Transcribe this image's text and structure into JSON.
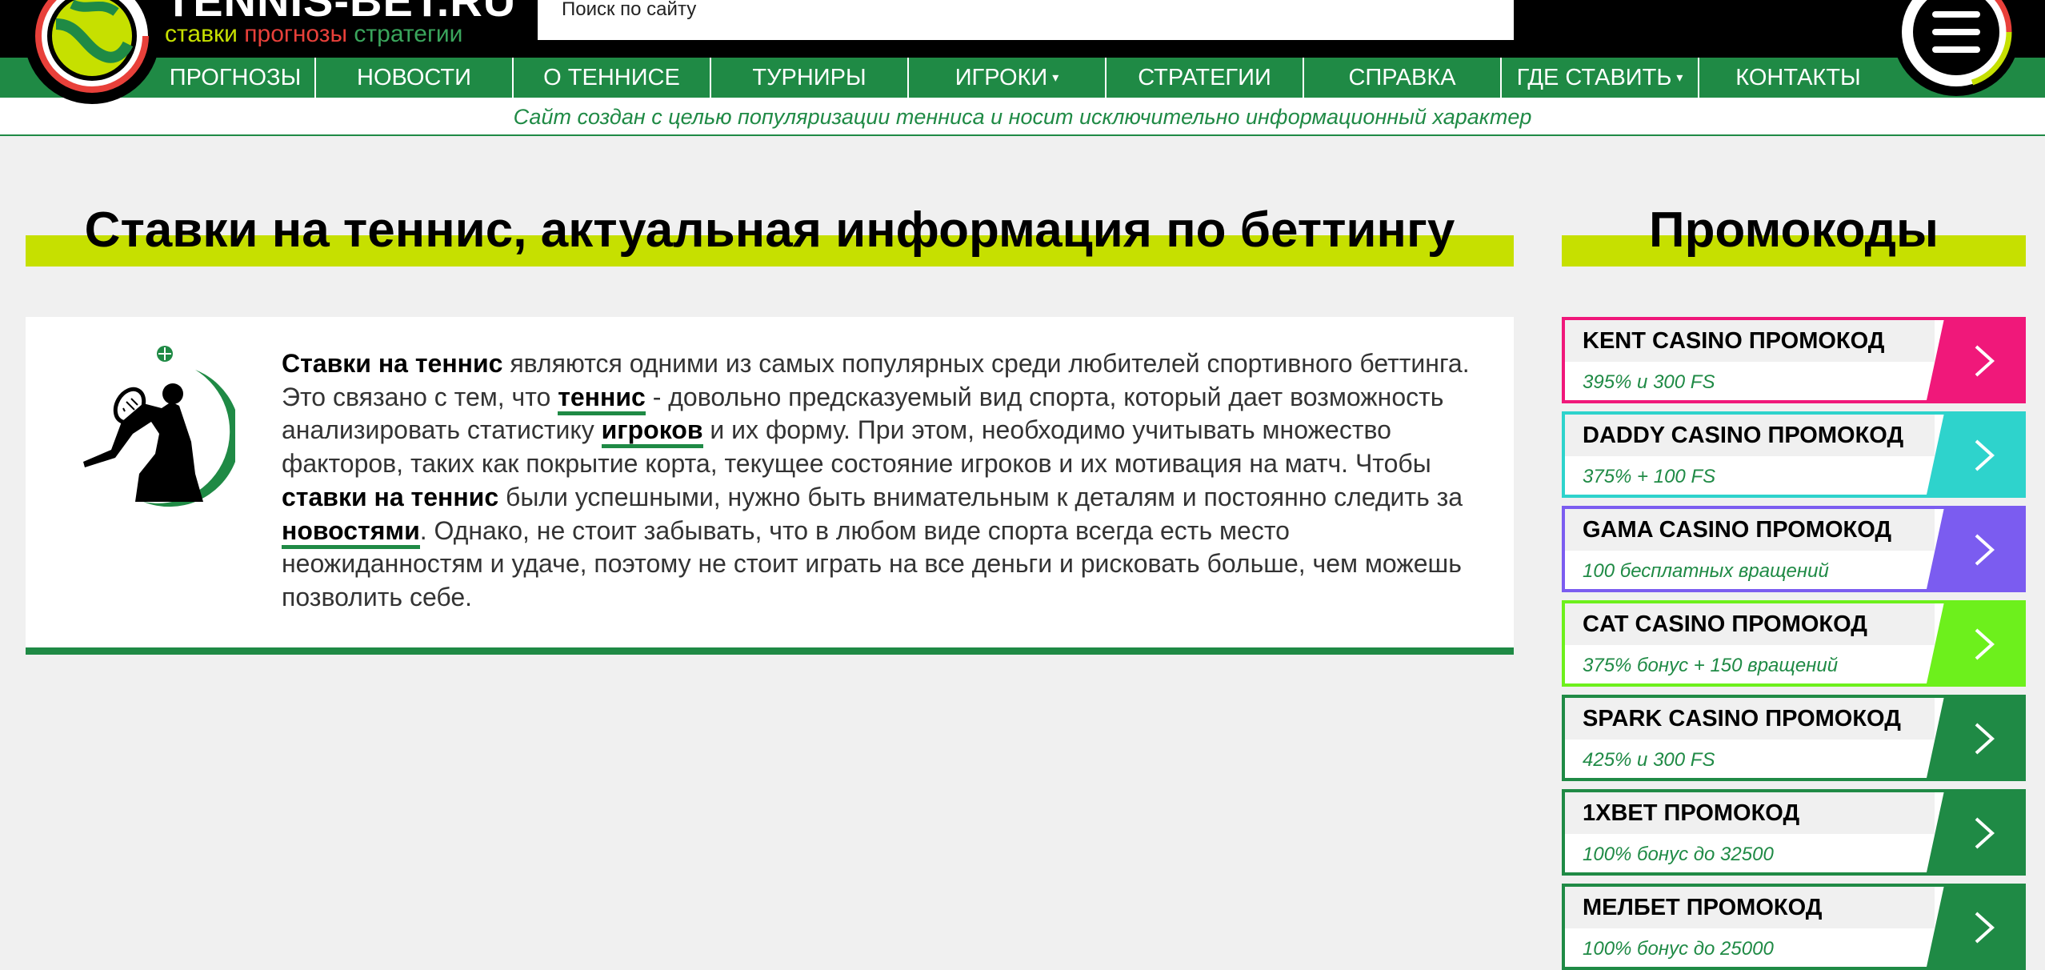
{
  "header": {
    "brand_name": "TENNIS-BET.RU",
    "tag_1": "ставки",
    "tag_2": "прогнозы",
    "tag_3": "стратегии",
    "search_placeholder": "Поиск по сайту",
    "logo_icon": "tennis-ball-logo-icon",
    "menu_icon": "hamburger-menu-icon"
  },
  "nav": {
    "items": [
      {
        "label": "ПРОГНОЗЫ",
        "dropdown": false
      },
      {
        "label": "НОВОСТИ",
        "dropdown": false
      },
      {
        "label": "О ТЕННИСЕ",
        "dropdown": false
      },
      {
        "label": "ТУРНИРЫ",
        "dropdown": false
      },
      {
        "label": "ИГРОКИ",
        "dropdown": true
      },
      {
        "label": "СТРАТЕГИИ",
        "dropdown": false
      },
      {
        "label": "СПРАВКА",
        "dropdown": false
      },
      {
        "label": "ГДЕ СТАВИТЬ",
        "dropdown": true
      },
      {
        "label": "КОНТАКТЫ",
        "dropdown": false
      }
    ],
    "caret": "▾"
  },
  "notice": "Сайт создан с целью популяризации тенниса и носит исключительно информационный характер",
  "main": {
    "heading": "Ставки на теннис, актуальная информация по беттингу",
    "intro": {
      "p1_bold": "Ставки на теннис",
      "p1": " являются одними из самых популярных среди любителей спортивного беттинга. Это связано с тем, что ",
      "link_tennis": "теннис",
      "p2": " - довольно предсказуемый вид спорта, который дает возможность анализировать статистику ",
      "link_players": "игроков",
      "p3": " и их форму. При этом, необходимо учитывать множество факторов, таких как покрытие корта, текущее состояние игроков и их мотивация на матч. Чтобы ",
      "p3_bold": "ставки на теннис",
      "p4": " были успешными, нужно быть внимательным к деталям и постоянно следить за ",
      "link_news": "новостями",
      "p5": ". Однако, не стоит забывать, что в любом виде спорта всегда есть место неожиданностям и удаче, поэтому не стоит играть на все деньги и рисковать больше, чем можешь позволить себе."
    }
  },
  "sidebar": {
    "heading": "Промокоды",
    "promos": [
      {
        "title": "KENT CASINO ПРОМОКОД",
        "sub": "395% и 300 FS",
        "color": "#f0187a"
      },
      {
        "title": "DADDY CASINO ПРОМОКОД",
        "sub": "375% + 100 FS",
        "color": "#2ed3cc"
      },
      {
        "title": "GAMA CASINO ПРОМОКОД",
        "sub": "100 бесплатных вращений",
        "color": "#7b5cf0"
      },
      {
        "title": "CAT CASINO ПРОМОКОД",
        "sub": "375% бонус + 150 вращений",
        "color": "#6df01c"
      },
      {
        "title": "SPARK CASINO ПРОМОКОД",
        "sub": "425% и 300 FS",
        "color": "#1f8a45"
      },
      {
        "title": "1XBET ПРОМОКОД",
        "sub": "100% бонус до 32500",
        "color": "#1f8a45"
      },
      {
        "title": "МЕЛБЕТ ПРОМОКОД",
        "sub": "100% бонус до 25000",
        "color": "#1f8a45"
      }
    ]
  }
}
